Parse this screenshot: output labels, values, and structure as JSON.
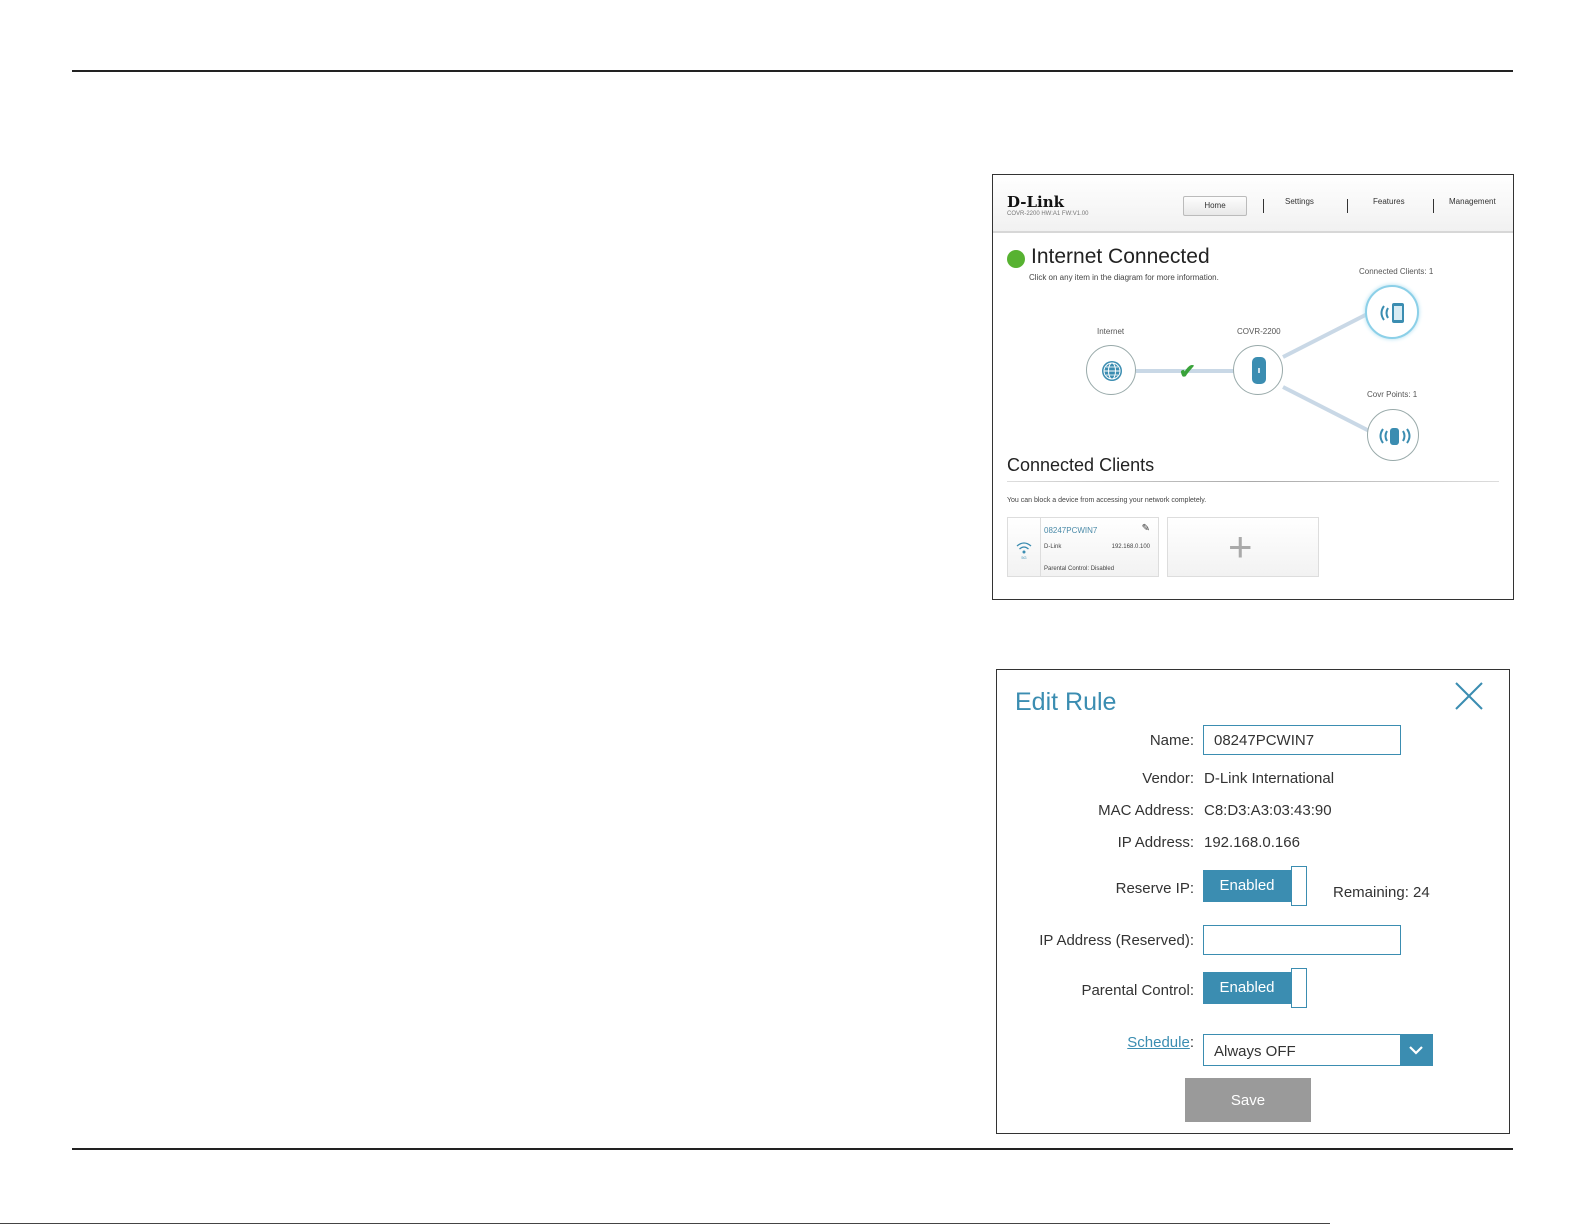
{
  "router_home": {
    "logo": "D-Link",
    "firmware": "COVR-2200 HW:A1 FW:V1.00",
    "nav": [
      "Home",
      "Settings",
      "Features",
      "Management"
    ],
    "status": "Internet Connected",
    "hint": "Click on any item in the diagram for more information.",
    "diagram": {
      "internet_label": "Internet",
      "router_label": "COVR-2200",
      "clients_label": "Connected Clients: 1",
      "covr_points_label": "Covr Points: 1"
    },
    "connected_clients": {
      "title": "Connected Clients",
      "hint": "You can block a device from accessing your network completely.",
      "client": {
        "name": "08247PCWIN7",
        "vendor": "D-Link",
        "ip": "192.168.0.100",
        "parental": "Parental Control: Disabled"
      }
    }
  },
  "edit_rule": {
    "title": "Edit Rule",
    "name_label": "Name:",
    "name_value": "08247PCWIN7",
    "vendor_label": "Vendor:",
    "vendor_value": "D-Link International",
    "mac_label": "MAC Address:",
    "mac_value": "C8:D3:A3:03:43:90",
    "ip_label": "IP Address:",
    "ip_value": "192.168.0.166",
    "reserve_label": "Reserve IP:",
    "reserve_state": "Enabled",
    "remaining": "Remaining: 24",
    "reserved_ip_label": "IP Address (Reserved):",
    "reserved_ip_value": "",
    "parental_label": "Parental Control:",
    "parental_state": "Enabled",
    "schedule_label": "Schedule",
    "schedule_colon": ":",
    "schedule_value": "Always OFF",
    "save": "Save"
  },
  "colors": {
    "accent": "#3b8db1",
    "status_green": "#57b231",
    "save_gray": "#9a9a9a"
  }
}
